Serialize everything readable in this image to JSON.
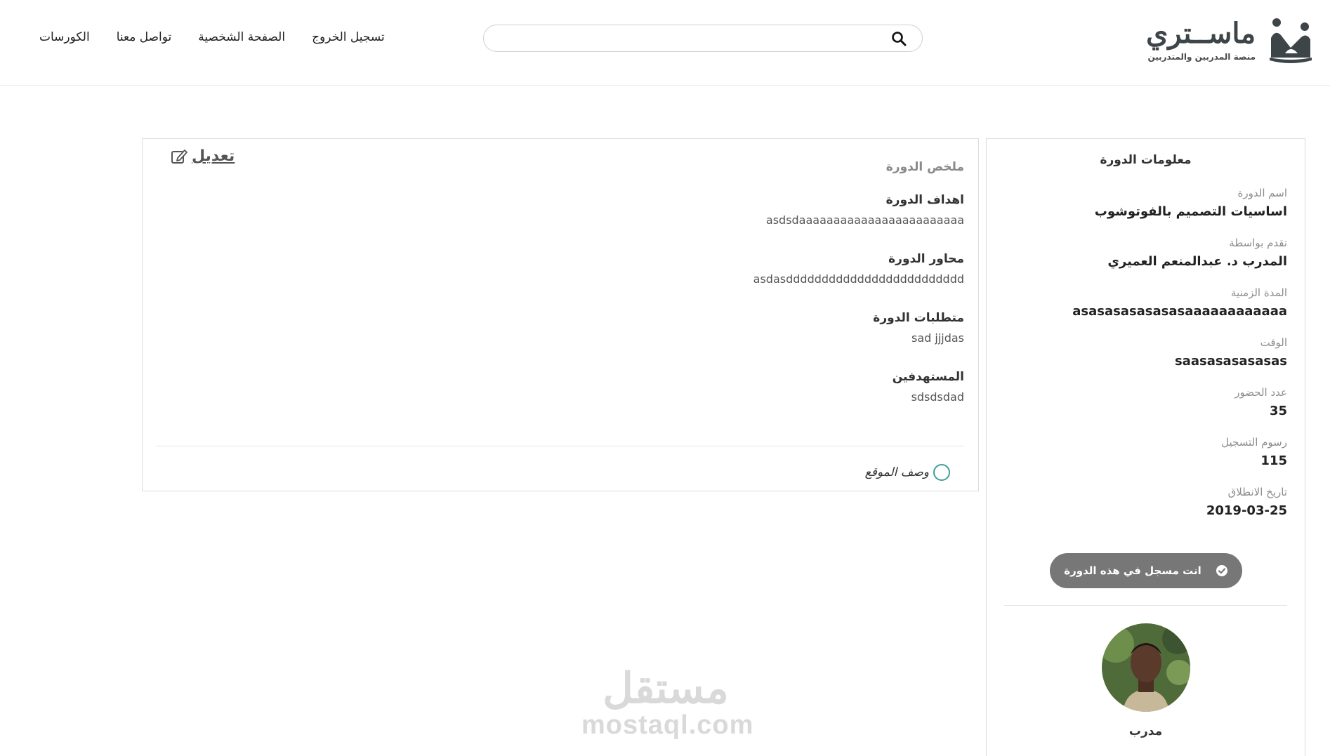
{
  "header": {
    "logo": {
      "name": "ماســتري",
      "tagline": "منصة المدربين والمتدربين"
    },
    "search": {
      "placeholder": "",
      "value": ""
    },
    "nav": [
      {
        "label": "الكورسات"
      },
      {
        "label": "تواصل معنا"
      },
      {
        "label": "الصفحة الشخصية"
      },
      {
        "label": "تسجيل الخروج"
      }
    ]
  },
  "summary": {
    "edit_label": "تعديل",
    "title": "ملخص الدورة",
    "sections": [
      {
        "label": "اهداف الدورة",
        "value": "asdsdaaaaaaaaaaaaaaaaaaaaaaaa"
      },
      {
        "label": "محاور الدورة",
        "value": "asdasddddddddddddddddddddddddd"
      },
      {
        "label": "متطلبات الدورة",
        "value": "sad jjjdas"
      },
      {
        "label": "المستهدفين",
        "value": "sdsdsdad"
      }
    ],
    "site_description_label": "وصف الموقع"
  },
  "course_info": {
    "title": "معلومات الدورة",
    "fields": [
      {
        "label": "اسم الدورة",
        "value": "اساسيات التصميم بالفوتوشوب"
      },
      {
        "label": "تقدم بواسطة",
        "value": "المدرب د. عبدالمنعم العميري"
      },
      {
        "label": "المدة الزمنية",
        "value": "asasasasasasasaaaaaaaaaaaa"
      },
      {
        "label": "الوقت",
        "value": "saasasasasasas"
      },
      {
        "label": "عدد الحضور",
        "value": "35"
      },
      {
        "label": "رسوم التسجيل",
        "value": "115"
      },
      {
        "label": "تاريخ الانطلاق",
        "value": "2019-03-25"
      }
    ],
    "enrolled_button": "انت مسجل في هذه الدورة",
    "trainer_role": "مدرب"
  },
  "watermark": {
    "arabic": "مستقل",
    "latin": "mostaql.com"
  },
  "colors": {
    "accent_ring": "#3f9f9a",
    "button_bg": "#777777",
    "logo_dark": "#3e4548",
    "label_gray": "#8d8d8d"
  },
  "icons": [
    "logo-mark-icon",
    "search-icon",
    "edit-icon",
    "circle-icon",
    "check-circle-icon"
  ]
}
